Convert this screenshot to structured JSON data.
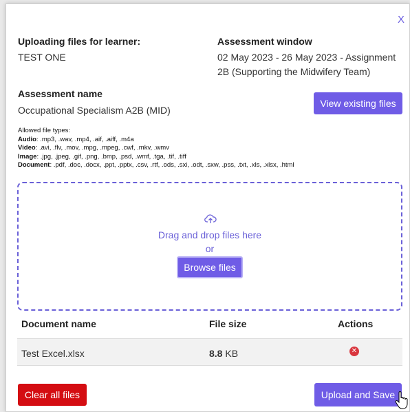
{
  "modal": {
    "close_label": "X"
  },
  "learner": {
    "heading": "Uploading files for learner:",
    "name": "TEST ONE"
  },
  "window": {
    "heading": "Assessment window",
    "line1": "02 May 2023 - 26 May 2023 - Assignment",
    "line2": "2B (Supporting the Midwifery Team)"
  },
  "assessment": {
    "heading": "Assessment name",
    "name": "Occupational Specialism A2B (MID)"
  },
  "buttons": {
    "view_existing": "View existing files",
    "browse": "Browse files",
    "clear_all": "Clear all files",
    "upload_save": "Upload and Save"
  },
  "file_types": {
    "heading": "Allowed file types",
    "audio_label": "Audio",
    "audio": ": .mp3, .wav, .mp4, .aif, .aiff, .m4a",
    "video_label": "Video",
    "video": ": .avi, .flv, .mov, .mpg, .mpeg, .cwf, .mkv, .wmv",
    "image_label": "Image",
    "image": ": .jpg, .jpeg, .gif, .png, .bmp, .psd, .wmf, .tga, .tif, .tiff",
    "document_label": "Document",
    "document": ": .pdf, .doc, .docx, .ppt, .pptx, .csv, .rtf, .ods, .sxi, .odt, .sxw, .pss, .txt, .xls, .xlsx, .html"
  },
  "dropzone": {
    "text": "Drag and drop files here",
    "or": "or"
  },
  "table": {
    "col_name": "Document name",
    "col_size": "File size",
    "col_actions": "Actions",
    "rows": [
      {
        "name": "Test Excel.xlsx",
        "size_value": "8.8",
        "size_unit": "KB"
      }
    ]
  },
  "colors": {
    "accent": "#6f5ce6",
    "danger": "#d40d12",
    "delete_icon": "#d9363e"
  }
}
